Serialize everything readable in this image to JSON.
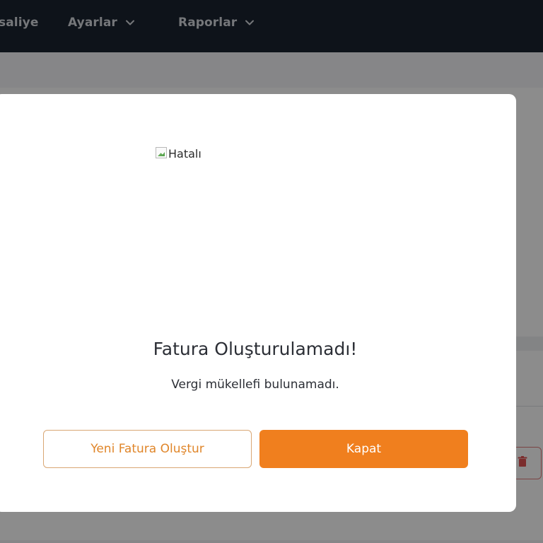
{
  "nav": {
    "items": [
      {
        "label": "saliye",
        "has_dropdown": false
      },
      {
        "label": "Ayarlar",
        "has_dropdown": true
      },
      {
        "label": "Raporlar",
        "has_dropdown": true
      }
    ]
  },
  "modal": {
    "image_alt": "Hatalı",
    "title": "Fatura Oluşturulamadı!",
    "message": "Vergi mükellefi bulunamadı.",
    "secondary_button": "Yeni Fatura Oluştur",
    "primary_button": "Kapat"
  },
  "colors": {
    "navbar_bg": "#1b2331",
    "accent_orange": "#f07f1e",
    "outline_border": "#d9a774",
    "danger": "#e05252"
  },
  "icons": {
    "dropdown": "chevron-down-icon",
    "delete": "trash-icon",
    "broken_image": "broken-image-icon"
  }
}
